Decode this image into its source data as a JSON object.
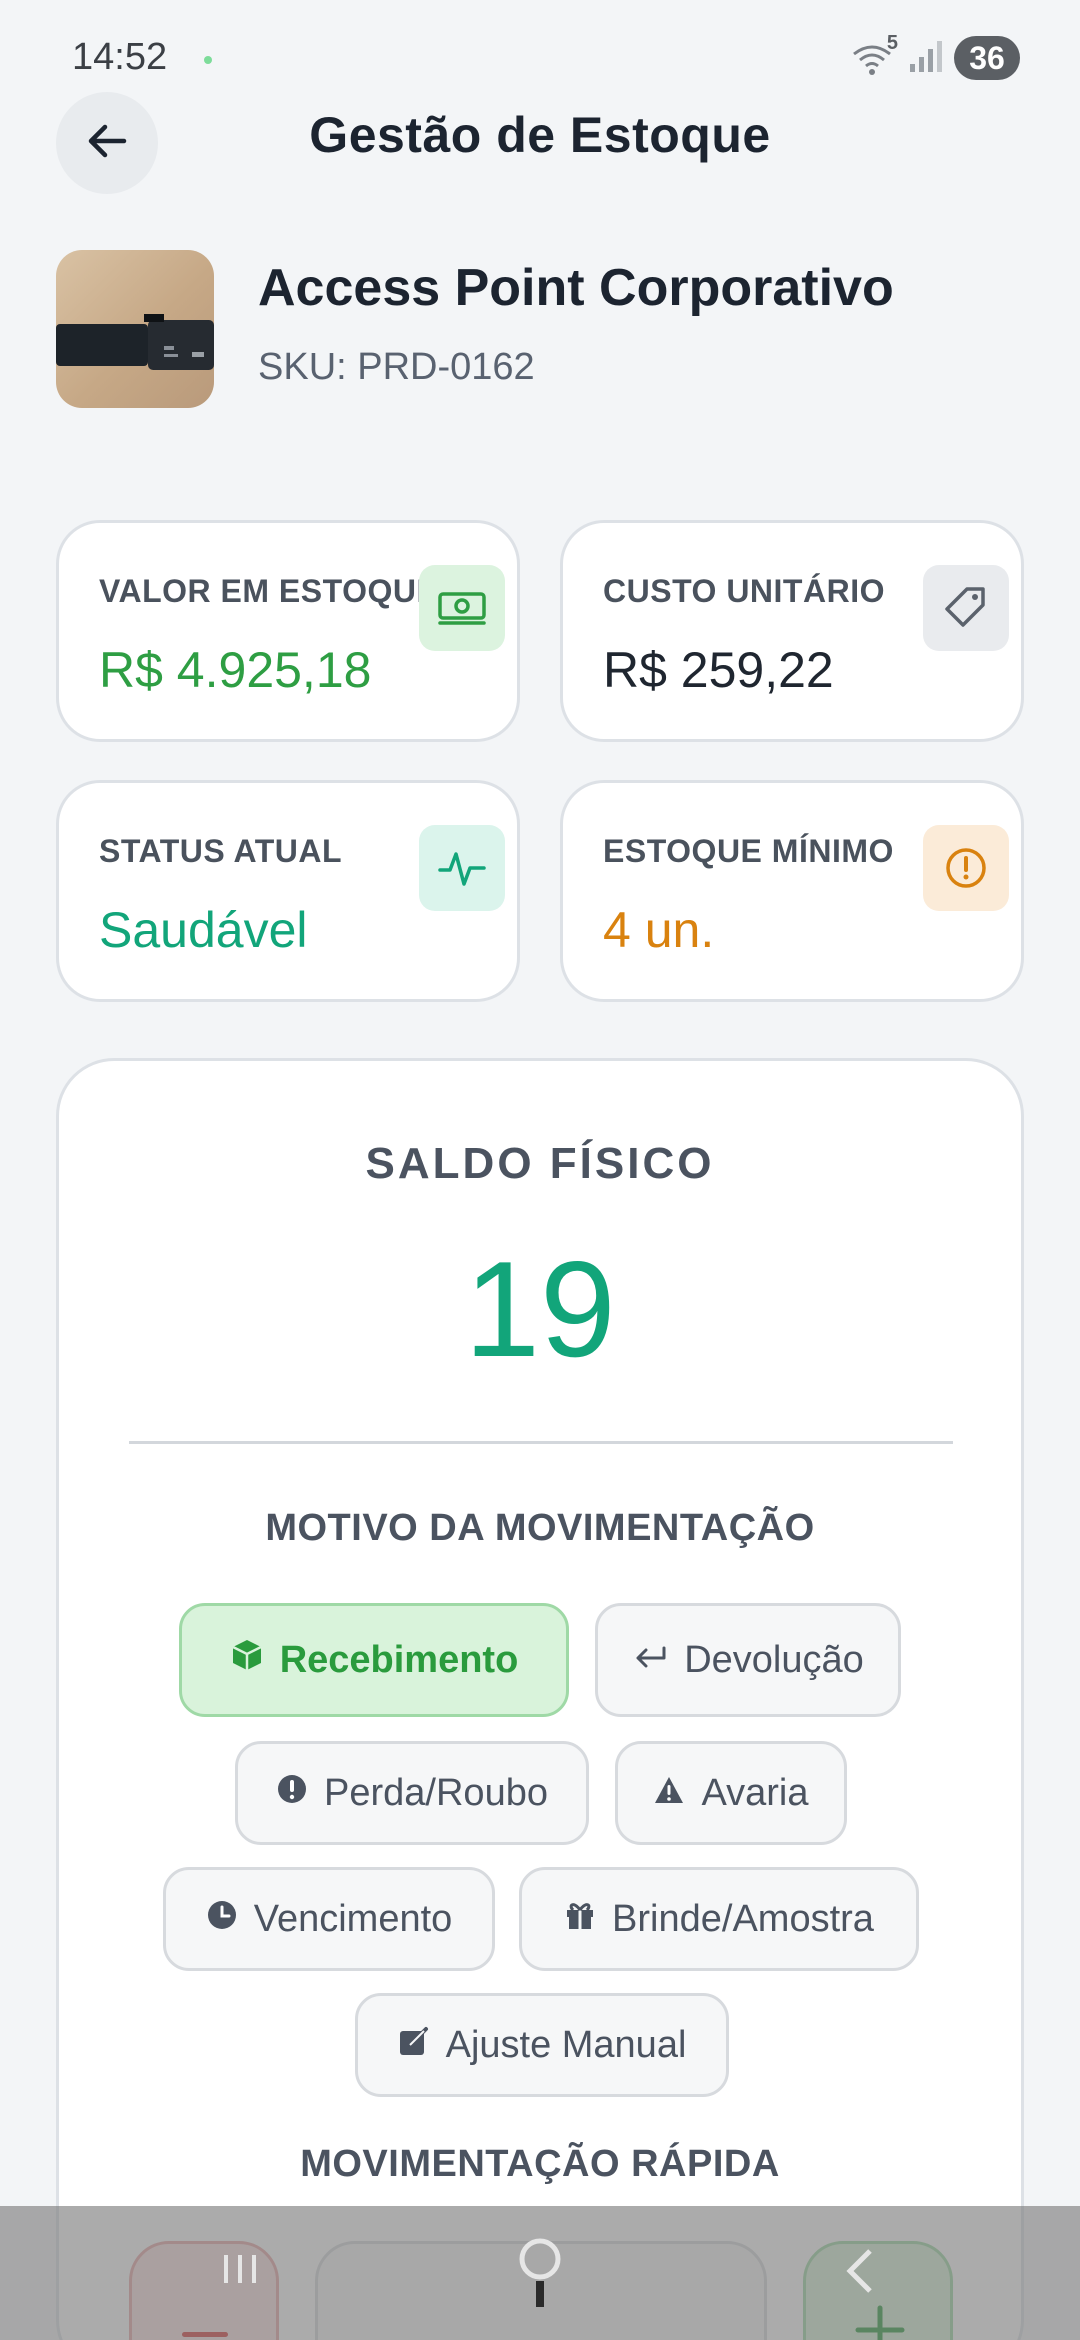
{
  "status_bar": {
    "time": "14:52",
    "wifi_label": "5",
    "battery": "36"
  },
  "header": {
    "title": "Gestão de Estoque",
    "back_icon": "arrow-left-icon"
  },
  "product": {
    "name": "Access Point Corporativo",
    "sku": "SKU: PRD-0162"
  },
  "cards": [
    {
      "label": "VALOR EM ESTOQUE",
      "value": "R$ 4.925,18",
      "icon": "banknote-icon",
      "value_color": "#2e9e43",
      "icon_bg": "#dcf3df",
      "icon_color": "#2e9e43"
    },
    {
      "label": "CUSTO UNITÁRIO",
      "value": "R$ 259,22",
      "icon": "tag-icon",
      "value_color": "#1f2630",
      "icon_bg": "#e9ebee",
      "icon_color": "#5b626c"
    },
    {
      "label": "STATUS ATUAL",
      "value": "Saudável",
      "icon": "activity-icon",
      "value_color": "#12a57a",
      "icon_bg": "#dbf4ec",
      "icon_color": "#12a57a"
    },
    {
      "label": "ESTOQUE MÍNIMO",
      "value": "4 un.",
      "icon": "alert-circle-icon",
      "value_color": "#d9820f",
      "icon_bg": "#fbebd8",
      "icon_color": "#d9820f"
    }
  ],
  "saldo": {
    "label": "SALDO FÍSICO",
    "value": "19"
  },
  "motivo": {
    "label": "MOTIVO DA MOVIMENTAÇÃO",
    "chips": [
      {
        "label": "Recebimento",
        "icon": "cube-icon",
        "active": true
      },
      {
        "label": "Devolução",
        "icon": "return-arrow-icon",
        "active": false
      },
      {
        "label": "Perda/Roubo",
        "icon": "exclamation-circle-icon",
        "active": false
      },
      {
        "label": "Avaria",
        "icon": "warning-triangle-icon",
        "active": false
      },
      {
        "label": "Vencimento",
        "icon": "clock-icon",
        "active": false
      },
      {
        "label": "Brinde/Amostra",
        "icon": "gift-icon",
        "active": false
      },
      {
        "label": "Ajuste Manual",
        "icon": "edit-icon",
        "active": false
      }
    ]
  },
  "rapida": {
    "label": "MOVIMENTAÇÃO RÁPIDA",
    "decrement_icon": "minus-icon",
    "increment_icon": "plus-icon"
  },
  "colors": {
    "accent_green": "#12a57a",
    "success_green": "#2e9e43",
    "warning_orange": "#d9820f",
    "danger_red": "#d83a3a"
  }
}
